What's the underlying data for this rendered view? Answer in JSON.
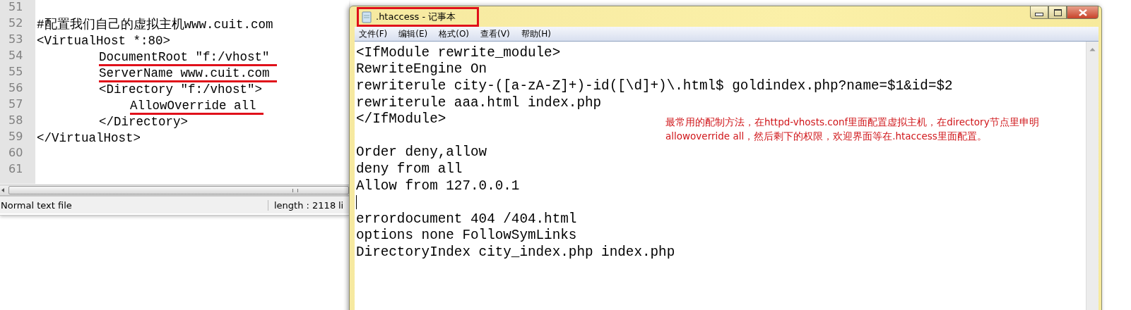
{
  "editor": {
    "lines": [
      {
        "number": "51"
      },
      {
        "number": "52",
        "text": "#配置我们自己的虚拟主机www.cuit.com",
        "underlined": false
      },
      {
        "number": "53",
        "text": "<VirtualHost *:80>",
        "underlined": false,
        "children": [
          {
            "number": "54",
            "text": "DocumentRoot \"f:/vhost\"",
            "underlined": true
          },
          {
            "number": "55",
            "text": "ServerName www.cuit.com",
            "underlined": true
          },
          {
            "number": "56",
            "text": "<Directory \"f:/vhost\">",
            "underlined": false,
            "children": [
              {
                "number": "57",
                "text": "AllowOverride all",
                "underlined": true
              }
            ]
          },
          {
            "number": "58",
            "text": "</Directory>",
            "underlined": false
          }
        ]
      },
      {
        "number": "59",
        "text": "</VirtualHost>",
        "underlined": false
      },
      {
        "number": "60"
      },
      {
        "number": "61"
      }
    ],
    "status_bar": {
      "file_type": "Normal text file",
      "length": "length : 2118",
      "column_3": "li"
    }
  },
  "notepad": {
    "title": ".htaccess - 记事本",
    "title_highlighted": true,
    "menu": [
      "文件(F)",
      "编辑(E)",
      "格式(O)",
      "查看(V)",
      "帮助(H)"
    ],
    "lines": [
      {
        "kind": "code",
        "text": "<IfModule rewrite_module>",
        "caret": false
      },
      {
        "kind": "code",
        "text": "RewriteEngine On",
        "caret": false
      },
      {
        "kind": "code",
        "text": "rewriterule city-([a-zA-Z]+)-id([\\d]+)\\.html$ goldindex.php?name=$1&id=$2",
        "caret": false
      },
      {
        "kind": "code",
        "text": "rewriterule aaa.html index.php",
        "caret": false
      },
      {
        "kind": "code",
        "text": "</IfModule>",
        "caret": false
      },
      {
        "kind": "blank",
        "caret": false
      },
      {
        "kind": "code",
        "text": "Order deny,allow",
        "caret": false
      },
      {
        "kind": "code",
        "text": "deny from all",
        "caret": false
      },
      {
        "kind": "code",
        "text": "Allow from 127.0.0.1",
        "caret": false
      },
      {
        "kind": "blank",
        "caret": true
      },
      {
        "kind": "code",
        "text": "errordocument 404 /404.html",
        "caret": false
      },
      {
        "kind": "code",
        "text": "options none FollowSymLinks",
        "caret": false
      },
      {
        "kind": "code",
        "text": "DirectoryIndex  city_index.php index.php",
        "caret": false
      }
    ],
    "annotation": [
      "最常用的配制方法，在httpd-vhosts.conf里面配置虚拟主机，在directory节点里申明",
      "allowoverride all，然后剩下的权限，欢迎界面等在.htaccess里面配置。"
    ]
  }
}
